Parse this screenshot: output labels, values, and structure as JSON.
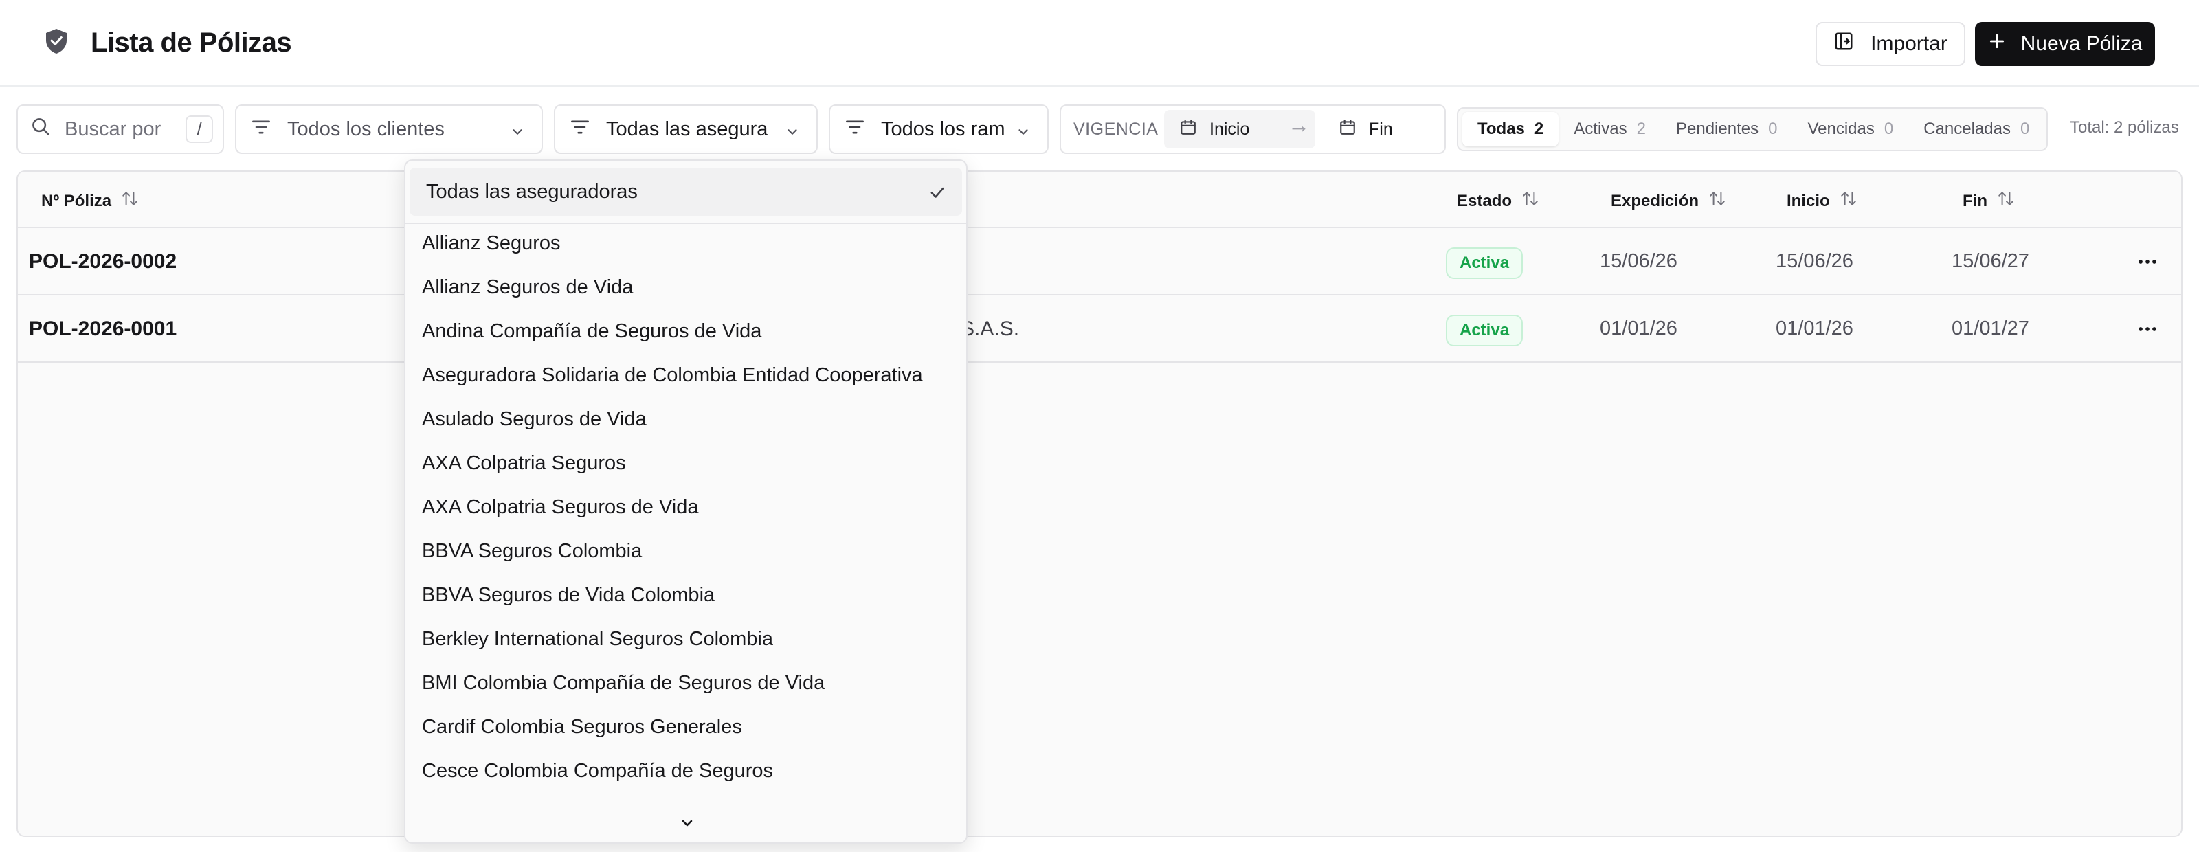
{
  "header": {
    "title": "Lista de Pólizas",
    "import_label": "Importar",
    "new_label": "Nueva Póliza"
  },
  "filters": {
    "search_placeholder": "Buscar por",
    "search_shortcut": "/",
    "clients_value": "Todos los clientes",
    "insurers_value": "Todas las aseguradoras",
    "ramos_value": "Todos los ramos",
    "vigencia_label": "VIGENCIA",
    "start_placeholder": "Inicio",
    "end_placeholder": "Fin"
  },
  "status_tabs": [
    {
      "label": "Todas",
      "count": "2",
      "active": true
    },
    {
      "label": "Activas",
      "count": "2"
    },
    {
      "label": "Pendientes",
      "count": "0"
    },
    {
      "label": "Vencidas",
      "count": "0"
    },
    {
      "label": "Canceladas",
      "count": "0"
    }
  ],
  "total_label": "Total: 2 pólizas",
  "table": {
    "columns": {
      "policy_no": "Nº Póliza",
      "status": "Estado",
      "issued": "Expedición",
      "start": "Inicio",
      "end": "Fin"
    },
    "rows": [
      {
        "policy_no": "POL-2026-0002",
        "client_fragment": "",
        "status": "Activa",
        "issued": "15/06/26",
        "start": "15/06/26",
        "end": "15/06/27"
      },
      {
        "policy_no": "POL-2026-0001",
        "client_fragment": "S.A.S.",
        "status": "Activa",
        "issued": "01/01/26",
        "start": "01/01/26",
        "end": "01/01/27"
      }
    ]
  },
  "dropdown": {
    "selected": "Todas las aseguradoras",
    "options": [
      "Allianz Seguros",
      "Allianz Seguros de Vida",
      "Andina Compañía de Seguros de Vida",
      "Aseguradora Solidaria de Colombia Entidad Cooperativa",
      "Asulado Seguros de Vida",
      "AXA Colpatria Seguros",
      "AXA Colpatria Seguros de Vida",
      "BBVA Seguros Colombia",
      "BBVA Seguros de Vida Colombia",
      "Berkley International Seguros Colombia",
      "BMI Colombia Compañía de Seguros de Vida",
      "Cardif Colombia Seguros Generales",
      "Cesce Colombia Compañía de Seguros"
    ]
  },
  "colors": {
    "primary_button": "#111113",
    "active_badge_text": "#16a34a",
    "active_badge_bg": "#f0fdf4"
  }
}
